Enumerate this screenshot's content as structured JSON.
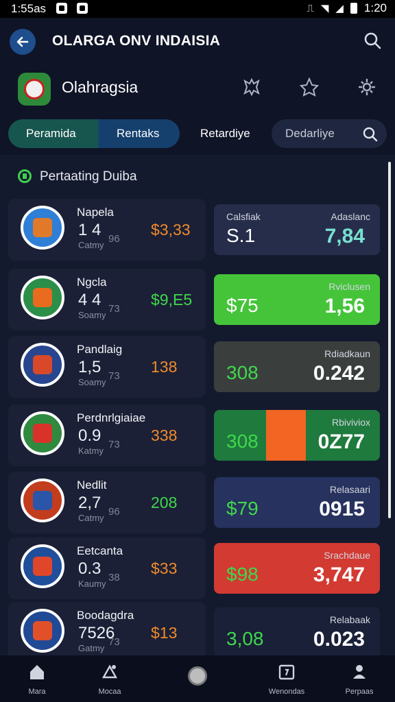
{
  "status_bar": {
    "time": "1:55as",
    "clock": "1:20"
  },
  "header": {
    "title": "OLARGA ONV INDAISIA",
    "brand": "Olahragsia"
  },
  "tabs": {
    "items": [
      "Peramida",
      "Rentaks",
      "Retardiye"
    ],
    "search_placeholder": "Dedarliye"
  },
  "section": {
    "title": "Pertaating Duiba"
  },
  "rows": [
    {
      "team": "Napela",
      "big": "1 4",
      "sub": "Catmy",
      "small": "96",
      "mid": "$3,33",
      "mid_color": "#f08a2b",
      "left_val": "S.1",
      "right_label": "Adaslanc",
      "right_top": "Calsfiak",
      "right_val": "7,84",
      "rval_color": "#78e0d0",
      "lval_color": "#ffffff",
      "bg": "#262d4a",
      "crest": "#2f7fd6",
      "crest_in": "#e07a2a"
    },
    {
      "team": "Ngcla",
      "big": "4 4",
      "sub": "Soamy",
      "small": "73",
      "mid": "$9,E5",
      "mid_color": "#3fd84b",
      "left_val": "$75",
      "right_label": "Rviclusen",
      "right_top": "",
      "right_val": "1,56",
      "rval_color": "#ffffff",
      "lval_color": "#ffffff",
      "bg": "#45c43a",
      "crest": "#2b8f4a",
      "crest_in": "#e86b1f"
    },
    {
      "team": "Pandlaig",
      "big": "1,5",
      "sub": "Soamy",
      "small": "73",
      "mid": "138",
      "mid_color": "#f08a2b",
      "left_val": "308",
      "right_label": "Rdiadkaun",
      "right_top": "",
      "right_val": "0.242",
      "rval_color": "#ffffff",
      "lval_color": "#3fd84b",
      "bg": "#3a3f3e",
      "crest": "#27468f",
      "crest_in": "#d8492a"
    },
    {
      "team": "Perdnrlgiaiae",
      "big": "0.9",
      "sub": "Katmy",
      "small": "73",
      "mid": "338",
      "mid_color": "#f08a2b",
      "left_val": "308",
      "right_label": "Rbiviviox",
      "right_top": "",
      "right_val": "0Z77",
      "rval_color": "#ffffff",
      "lval_color": "#3fd84b",
      "bg": "#1f7a3d",
      "crest": "#2f8a3f",
      "crest_in": "#d8322a"
    },
    {
      "team": "Nedlit",
      "big": "2,7",
      "sub": "Catmy",
      "small": "96",
      "mid": "208",
      "mid_color": "#3fd84b",
      "left_val": "$79",
      "right_label": "Relasaari",
      "right_top": "",
      "right_val": "0915",
      "rval_color": "#ffffff",
      "lval_color": "#3fd84b",
      "bg": "#27325e",
      "crest": "#c23c1e",
      "crest_in": "#2a55a8"
    },
    {
      "team": "Eetcanta",
      "big": "0.3",
      "sub": "Kaumy",
      "small": "38",
      "mid": "$33",
      "mid_color": "#f08a2b",
      "left_val": "$98",
      "right_label": "Srachdaue",
      "right_top": "",
      "right_val": "3,747",
      "rval_color": "#ffffff",
      "lval_color": "#3fd84b",
      "bg": "#d23a32",
      "crest": "#1f4f9a",
      "crest_in": "#e0462a"
    },
    {
      "team": "Boodagdra",
      "big": "7526",
      "sub": "Gatmy",
      "small": "73",
      "mid": "$13",
      "mid_color": "#f08a2b",
      "left_val": "3,08",
      "right_label": "Relabaak",
      "right_top": "",
      "right_val": "0.023",
      "rval_color": "#ffffff",
      "lval_color": "#3fd84b",
      "bg": "#1a2038",
      "crest": "#214a96",
      "crest_in": "#e2502a"
    }
  ],
  "bottom_nav": [
    {
      "label": "Mara",
      "icon": "home-icon"
    },
    {
      "label": "Mocaa",
      "icon": "fitness-icon"
    },
    {
      "label": "",
      "icon": "home-button"
    },
    {
      "label": "Wenondas",
      "icon": "calendar-icon"
    },
    {
      "label": "Perpaas",
      "icon": "profile-icon"
    }
  ]
}
